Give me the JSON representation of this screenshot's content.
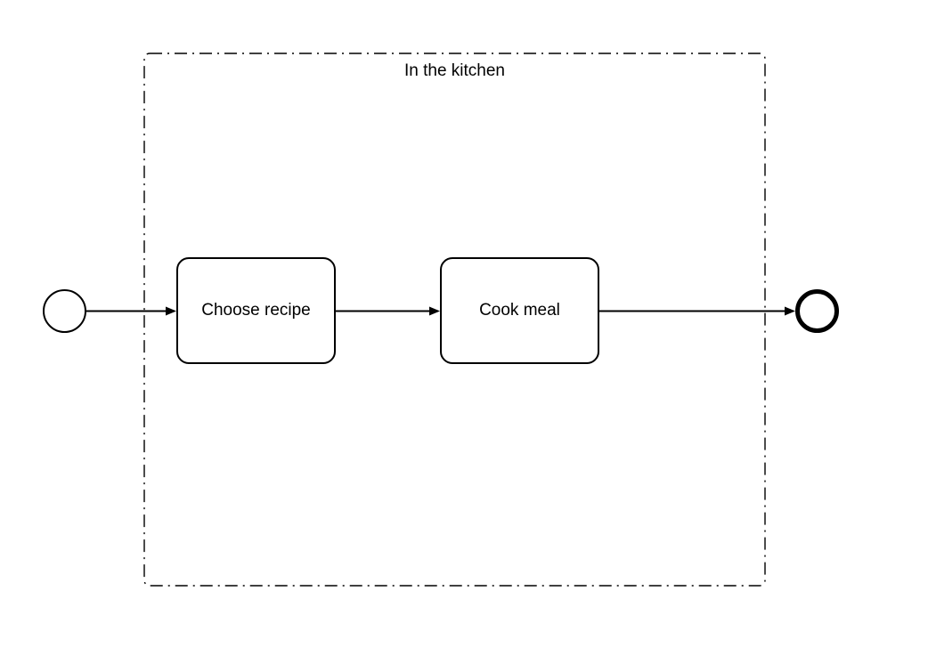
{
  "group": {
    "label": "In the kitchen"
  },
  "tasks": {
    "task1": {
      "label": "Choose recipe"
    },
    "task2": {
      "label": "Cook meal"
    }
  }
}
